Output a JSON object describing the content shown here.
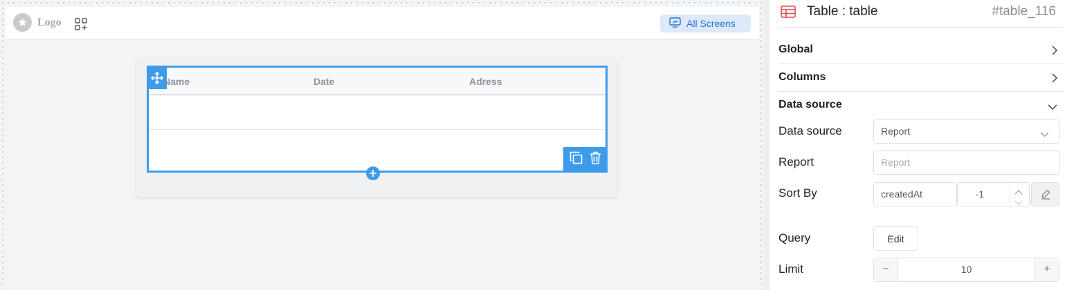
{
  "canvas": {
    "logo_text": "Logo",
    "all_screens_label": "All Screens",
    "table": {
      "columns": [
        "Name",
        "Date",
        "Adress"
      ]
    },
    "icons": {
      "logo": "star-icon",
      "apps": "apps-add-icon",
      "screens": "monitor-icon",
      "move": "move-icon",
      "copy": "copy-icon",
      "delete": "trash-icon",
      "add": "plus-icon"
    }
  },
  "panel": {
    "title": "Table : table",
    "id": "#table_116",
    "sections": {
      "global": "Global",
      "columns": "Columns",
      "data_source": "Data source"
    },
    "fields": {
      "data_source_label": "Data source",
      "data_source_value": "Report",
      "report_label": "Report",
      "report_placeholder": "Report",
      "sort_by_label": "Sort By",
      "sort_by_field": "createdAt",
      "sort_by_order": "-1",
      "query_label": "Query",
      "query_button": "Edit",
      "limit_label": "Limit",
      "limit_value": "10",
      "limit_minus": "−",
      "limit_plus": "+"
    }
  },
  "colors": {
    "accent": "#3d9bea",
    "all_screens_bg": "#dde9fb",
    "all_screens_text": "#2c6fd6",
    "table_icon": "#e5484d"
  }
}
